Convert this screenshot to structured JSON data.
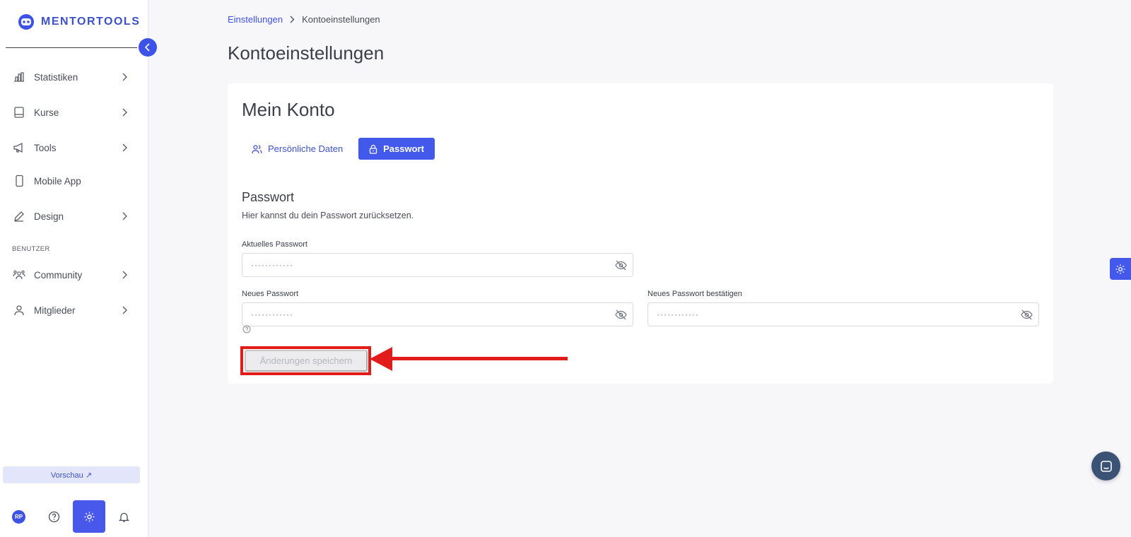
{
  "app": {
    "logo_text": "MENTORTOOLS"
  },
  "sidebar": {
    "items": [
      {
        "label": "Statistiken",
        "icon": "bar-chart-icon",
        "has_chevron": true
      },
      {
        "label": "Kurse",
        "icon": "book-icon",
        "has_chevron": true
      },
      {
        "label": "Tools",
        "icon": "megaphone-icon",
        "has_chevron": true
      },
      {
        "label": "Mobile App",
        "icon": "mobile-phone-icon",
        "has_chevron": false
      },
      {
        "label": "Design",
        "icon": "pencil-icon",
        "has_chevron": true
      }
    ],
    "section_label": "BENUTZER",
    "user_items": [
      {
        "label": "Community",
        "icon": "community-icon",
        "has_chevron": true
      },
      {
        "label": "Mitglieder",
        "icon": "user-icon",
        "has_chevron": true
      }
    ],
    "preview_label": "Vorschau ↗",
    "avatar_initials": "RP"
  },
  "breadcrumb": {
    "parent": "Einstellungen",
    "current": "Kontoeinstellungen"
  },
  "page_title": "Kontoeinstellungen",
  "card": {
    "title": "Mein Konto",
    "tabs": [
      {
        "label": "Persönliche Daten",
        "icon": "users-icon",
        "active": false
      },
      {
        "label": "Passwort",
        "icon": "lock-icon",
        "active": true
      }
    ],
    "section_title": "Passwort",
    "section_description": "Hier kannst du dein Passwort zurücksetzen.",
    "fields": {
      "current": {
        "label": "Aktuelles Passwort",
        "placeholder": "············"
      },
      "new": {
        "label": "Neues Passwort",
        "placeholder": "············"
      },
      "confirm": {
        "label": "Neues Passwort bestätigen",
        "placeholder": "············"
      }
    },
    "save_label": "Änderungen speichern"
  },
  "colors": {
    "accent": "#4359ec",
    "highlight": "#e21b1b",
    "chat": "#3a5374"
  }
}
